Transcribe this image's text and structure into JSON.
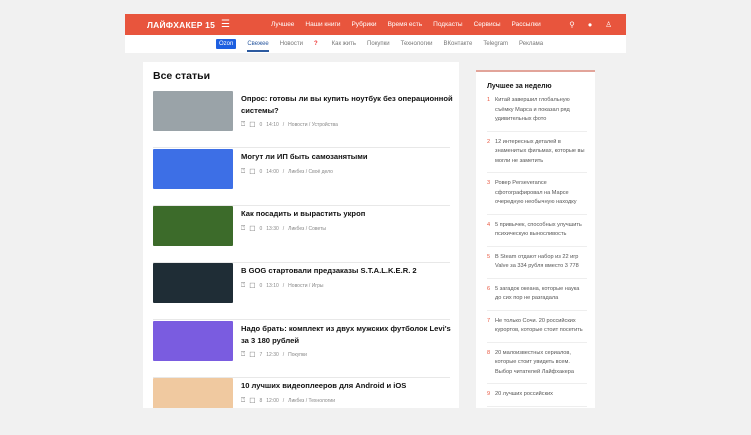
{
  "header": {
    "logo": "ЛАЙФХАКЕР 15",
    "nav": [
      "Лучшее",
      "Наши книги",
      "Рубрики",
      "Время есть",
      "Подкасты",
      "Сервисы",
      "Рассылки"
    ]
  },
  "subnav": {
    "ozon": "Ozon",
    "items": [
      "Свежее",
      "Новости",
      "Как жить",
      "Покупки",
      "Технологии",
      "ВКонтакте",
      "Telegram",
      "Реклама"
    ],
    "question": "?"
  },
  "main": {
    "heading": "Все статьи",
    "articles": [
      {
        "title": "Опрос: готовы ли вы купить ноутбук без операционной системы?",
        "comments": "0",
        "time": "14:10",
        "cats": "Новости / Устройства",
        "color": "#9aa3a8"
      },
      {
        "title": "Могут ли ИП быть самозанятыми",
        "comments": "0",
        "time": "14:00",
        "cats": "Ликбез / Своё дело",
        "color": "#3d6fe6"
      },
      {
        "title": "Как посадить и вырастить укроп",
        "comments": "0",
        "time": "13:30",
        "cats": "Ликбез / Советы",
        "color": "#3c6b2a"
      },
      {
        "title": "В GOG стартовали предзаказы S.T.A.L.K.E.R. 2",
        "comments": "0",
        "time": "13:10",
        "cats": "Новости / Игры",
        "color": "#1f2d36"
      },
      {
        "title": "Надо брать: комплект из двух мужских футболок Levi's за 3 180 рублей",
        "comments": "7",
        "time": "12:30",
        "cats": "Покупки",
        "color": "#7a5ce0"
      },
      {
        "title": "10 лучших видеоплееров для Android и iOS",
        "comments": "8",
        "time": "12:00",
        "cats": "Ликбез / Технологии",
        "color": "#f0c9a0"
      }
    ]
  },
  "sidebar": {
    "heading": "Лучшее за неделю",
    "items": [
      "Китай завершил глобальную съёмку Марса и показал ряд удивительных фото",
      "12 интересных деталей в знаменитых фильмах, которые вы могли не заметить",
      "Ровер Perseverance сфотографировал на Марсе очередную необычную находку",
      "5 привычек, способных улучшить психическую выносливость",
      "В Steam отдают набор из 22 игр Valve за 334 рубля вместо 3 778",
      "5 загадок океана, которые наука до сих пор не разгадала",
      "Не только Сочи. 20 российских курортов, которые стоит посетить",
      "20 малоизвестных сериалов, которые стоит увидеть всем. Выбор читателей Лайфхакера",
      "20 лучших российских"
    ]
  }
}
